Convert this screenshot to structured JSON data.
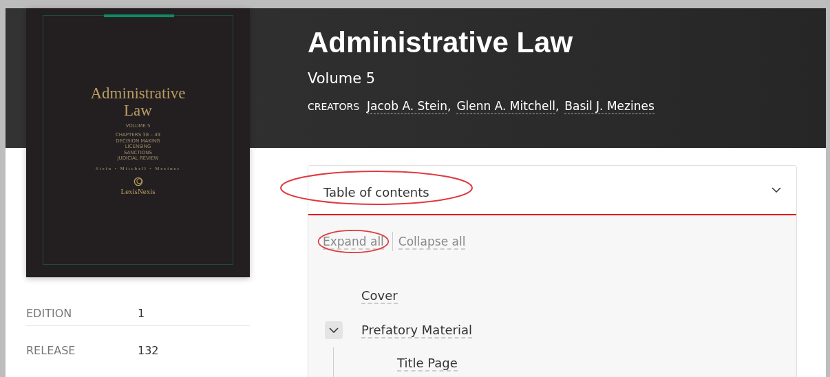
{
  "cover": {
    "title": "Administrative Law",
    "volume": "VOLUME 5",
    "topics": [
      "CHAPTERS 38 – 49",
      "DECISION MAKING",
      "LICENSING",
      "SANCTIONS",
      "JUDICIAL REVIEW"
    ],
    "authors": "Stein • Mitchell • Mezines",
    "publisher": "LexisNexis"
  },
  "title": "Administrative Law",
  "subtitle": "Volume 5",
  "creators": {
    "label": "CREATORS",
    "names": [
      {
        "name": "Jacob A. Stein",
        "separator": ","
      },
      {
        "name": "Glenn A. Mitchell",
        "separator": ","
      },
      {
        "name": "Basil J. Mezines"
      }
    ]
  },
  "details": [
    {
      "label": "EDITION",
      "value": "1"
    },
    {
      "label": "RELEASE",
      "value": "132"
    }
  ],
  "toc": {
    "title": "Table of contents",
    "circled": true,
    "expanded": true,
    "actions": [
      {
        "label": "Expand all",
        "circled": true
      },
      {
        "label": "Collapse all",
        "circled": false
      }
    ],
    "items": [
      {
        "label": "Cover"
      },
      {
        "label": "Prefatory Material",
        "expanded": true,
        "children": [
          {
            "label": "Title Page"
          }
        ]
      }
    ]
  }
}
